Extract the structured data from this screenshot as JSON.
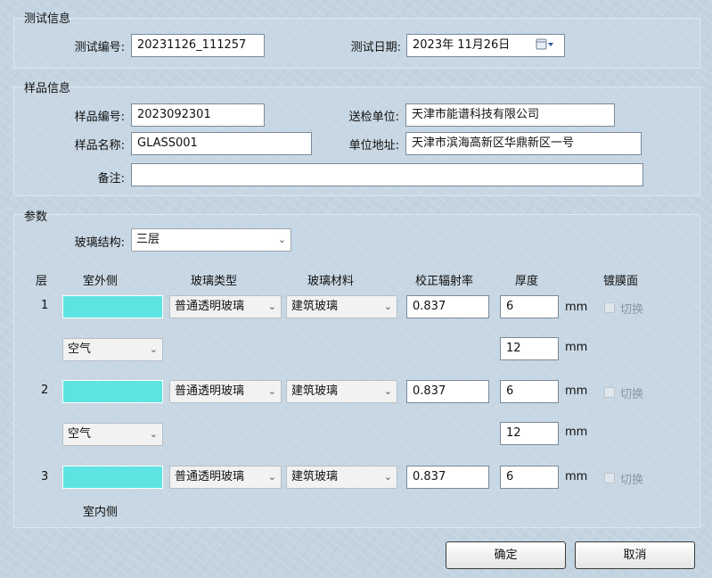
{
  "test_info": {
    "title": "测试信息",
    "test_no_label": "测试编号:",
    "test_no": "20231126_111257",
    "test_date_label": "测试日期:",
    "test_date": "2023年 11月26日"
  },
  "sample_info": {
    "title": "样品信息",
    "sample_no_label": "样品编号:",
    "sample_no": "2023092301",
    "sender_label": "送检单位:",
    "sender": "天津市能谱科技有限公司",
    "sample_name_label": "样品名称:",
    "sample_name": "GLASS001",
    "address_label": "单位地址:",
    "address": "天津市滨海高新区华鼎新区一号",
    "remark_label": "备注:",
    "remark": ""
  },
  "params": {
    "title": "参数",
    "structure_label": "玻璃结构:",
    "structure_value": "三层",
    "headers": {
      "layer": "层",
      "outside": "室外侧",
      "glass_type": "玻璃类型",
      "glass_material": "玻璃材料",
      "emissivity": "校正辐射率",
      "thickness": "厚度",
      "coating": "镀膜面"
    },
    "layers": [
      {
        "index": "1",
        "glass_type": "普通透明玻璃",
        "material": "建筑玻璃",
        "emissivity": "0.837",
        "thickness": "6",
        "unit": "mm",
        "coating_label": "切换"
      },
      {
        "index": "2",
        "glass_type": "普通透明玻璃",
        "material": "建筑玻璃",
        "emissivity": "0.837",
        "thickness": "6",
        "unit": "mm",
        "coating_label": "切换"
      },
      {
        "index": "3",
        "glass_type": "普通透明玻璃",
        "material": "建筑玻璃",
        "emissivity": "0.837",
        "thickness": "6",
        "unit": "mm",
        "coating_label": "切换"
      }
    ],
    "gaps": [
      {
        "gas": "空气",
        "thickness": "12",
        "unit": "mm"
      },
      {
        "gas": "空气",
        "thickness": "12",
        "unit": "mm"
      }
    ],
    "inside_label": "室内侧"
  },
  "buttons": {
    "ok": "确定",
    "cancel": "取消"
  },
  "colors": {
    "glass_swatch": "#5ee3e3",
    "background": "#c3d4e0"
  },
  "icons": {
    "calendar": "calendar-icon",
    "dropdown": "chevron-down-icon"
  }
}
